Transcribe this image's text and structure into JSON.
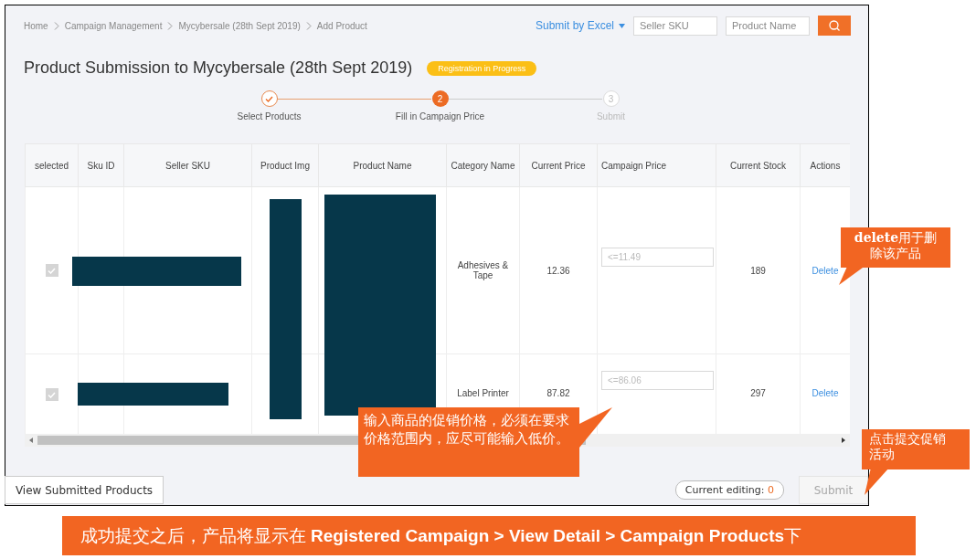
{
  "breadcrumb": [
    "Home",
    "Campaign Management",
    "Mycybersale (28th Sept 2019)",
    "Add Product"
  ],
  "toolbar": {
    "submit_by_excel": "Submit by Excel",
    "seller_sku_placeholder": "Seller SKU",
    "product_name_placeholder": "Product Name"
  },
  "title": "Product Submission to Mycybersale (28th Sept 2019)",
  "status_badge": "Registration in Progress",
  "steps": [
    {
      "label": "Select Products",
      "done": true,
      "selected": false
    },
    {
      "number": "2",
      "label": "Fill in Campaign Price",
      "done": false,
      "selected": true
    },
    {
      "number": "3",
      "label": "Submit",
      "done": false,
      "selected": false
    }
  ],
  "table": {
    "columns": [
      "selected",
      "Sku ID",
      "Seller SKU",
      "Product Img",
      "Product Name",
      "Category Name",
      "Current Price",
      "Campaign Price",
      "Current Stock",
      "Actions"
    ],
    "redacted": true,
    "rows": [
      {
        "checked": true,
        "disabled": true,
        "category": "Adhesives & Tape",
        "current_price": "12.36",
        "campaign_price_placeholder": "<=11.49",
        "current_stock": "189",
        "action": "Delete"
      },
      {
        "checked": true,
        "disabled": true,
        "category": "Label Printer",
        "current_price": "87.82",
        "campaign_price_placeholder": "<=86.06",
        "current_stock": "297",
        "action": "Delete"
      }
    ]
  },
  "footer": {
    "view_submitted": "View Submitted Products",
    "current_editing_label": "Current editing:",
    "current_editing_count": "0",
    "submit": {
      "label": "Submit",
      "disabled": true
    }
  },
  "annotations": [
    {
      "kind": "delete",
      "text": "**delete**用于删除该产品"
    },
    {
      "kind": "price",
      "text": " 输入商品的促销价格，必须在要求价格范围内，应尽可能输入低价。"
    },
    {
      "kind": "submit",
      "text": "点击提交促销活动"
    }
  ],
  "banner": "成功提交之后，产品将显示在 **Registered Campaign > View Detail > Campaign Products**下"
}
